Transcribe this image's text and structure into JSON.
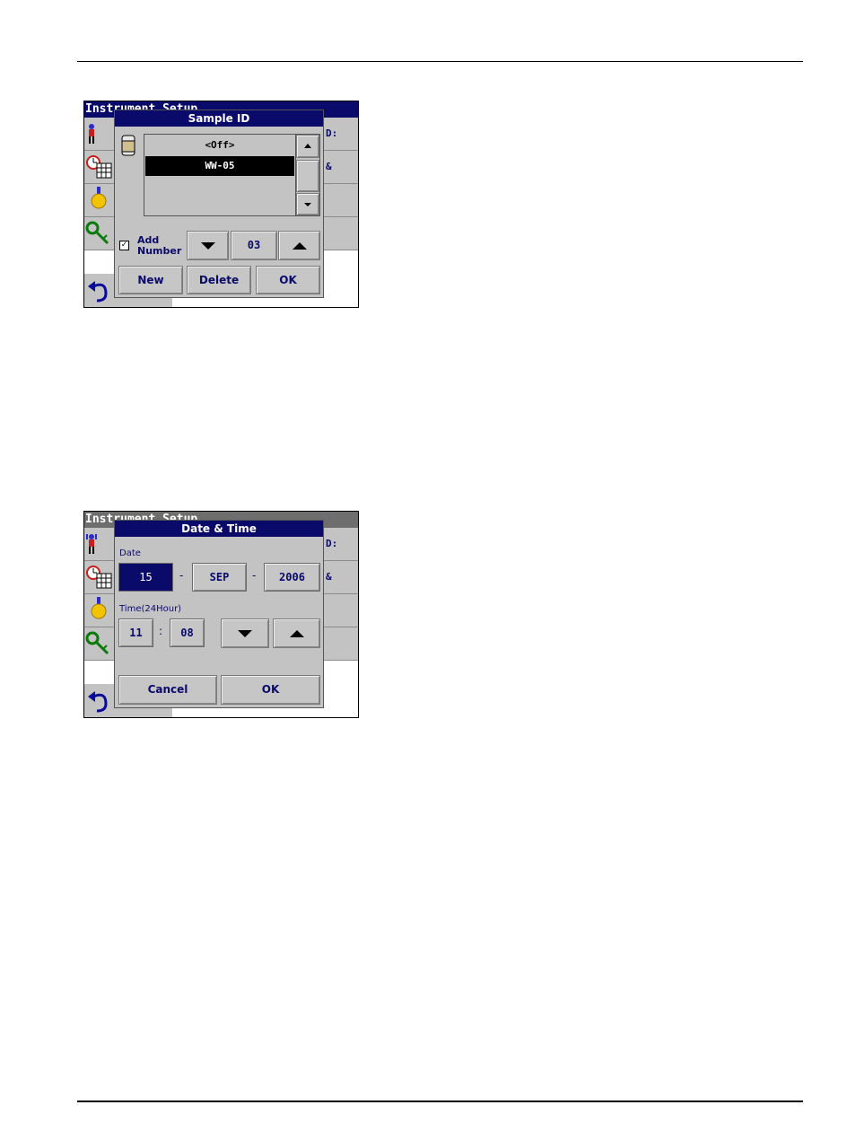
{
  "screen1": {
    "window_title": "Instrument Setup",
    "right_labels": [
      "D:",
      "&",
      "",
      ""
    ],
    "dialog": {
      "title": "Sample ID",
      "list_items": [
        "<Off>",
        "WW-05"
      ],
      "selected_index": 1,
      "add_number_label_line1": "Add",
      "add_number_label_line2": "Number",
      "add_number_checked": true,
      "number_value": "03",
      "buttons": {
        "new": "New",
        "delete": "Delete",
        "ok": "OK"
      }
    }
  },
  "screen2": {
    "window_title": "Instrument Setup",
    "right_labels": [
      "D:",
      "&",
      "",
      ""
    ],
    "dialog": {
      "title": "Date & Time",
      "date_label": "Date",
      "day": "15",
      "month": "SEP",
      "year": "2006",
      "separator": "-",
      "time_label": "Time(24Hour)",
      "hour": "11",
      "time_separator": ":",
      "minute": "08",
      "buttons": {
        "cancel": "Cancel",
        "ok": "OK"
      }
    }
  },
  "colors": {
    "title_blue": "#0a0a6a",
    "panel_gray": "#c3c3c3"
  }
}
